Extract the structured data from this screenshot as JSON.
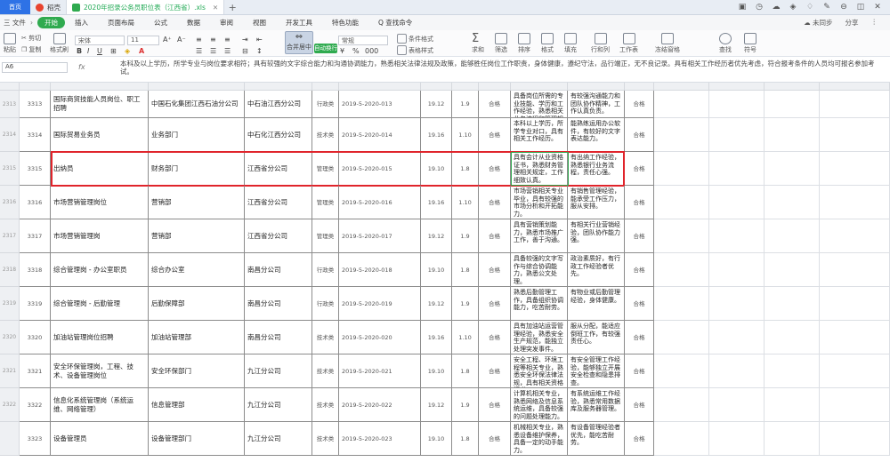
{
  "tabs": {
    "home_label": "首页",
    "items": [
      {
        "label": "稻壳",
        "color": "#e8432e",
        "active": false
      },
      {
        "label": "2020年招录公务员职位表（江西省）.xls",
        "color": "#2faa4f",
        "active": true
      }
    ],
    "plus": "+",
    "right_icons": [
      "▣",
      "◷",
      "☁",
      "◈",
      "♢",
      "✎",
      "⊖",
      "◫",
      "✕"
    ]
  },
  "menu": {
    "file": "三 文件",
    "items": [
      "开始",
      "插入",
      "页面布局",
      "公式",
      "数据",
      "审阅",
      "视图",
      "开发工具",
      "特色功能",
      "Q 查找命令"
    ],
    "active_index": 0,
    "right": [
      "☁ 未同步",
      "分享",
      "⋮"
    ]
  },
  "ribbon": {
    "cut": "✂ 剪切",
    "copy": "❐ 复制",
    "format_painter": "格式刷",
    "paste": "粘贴",
    "font_name": "宋体",
    "font_size": "11",
    "merge_center": "合并居中",
    "wrap": "自动换行",
    "currency": "常规",
    "cond_format": "条件格式",
    "table_style": "表格样式",
    "sum": "求和",
    "filter": "筛选",
    "sort": "排序",
    "format": "格式",
    "fill": "填充",
    "row_col": "行和列",
    "worksheet": "工作表",
    "freeze": "冻结窗格",
    "find": "查找",
    "symbol": "符号"
  },
  "formula_bar": {
    "namebox": "A6",
    "fx": "fx",
    "text": "本科及以上学历，所学专业与岗位要求相符；具有较强的文字综合能力和沟通协调能力，熟悉相关法律法规及政策，能够胜任岗位工作职责，身体健康，遵纪守法，品行端正，无不良记录。具有相关工作经历者优先考虑，符合报考条件的人员均可报名参加考试。"
  },
  "sheet": {
    "row_numbers": [
      "2313",
      "2314",
      "2315",
      "2316",
      "2317",
      "2318",
      "2319",
      "2320",
      "2321",
      "2322"
    ],
    "rows": [
      {
        "id": "3313",
        "name": "国际商贸技能人员岗位、职工招聘",
        "dept": "中国石化集团江西石油分公司",
        "org": "中石油江西分公司",
        "type": "行政类",
        "code": "2019-5-2020-013",
        "n1": "19.12",
        "n2": "1.9",
        "flag": "合格",
        "d1": "具备岗位所需的专业技能、学历和工作经验，熟悉相关业务流程和管理规定。",
        "d2": "有较强沟通能力和团队协作精神，工作认真负责。",
        "ex": "合格"
      },
      {
        "id": "3314",
        "name": "国际贸易业务员",
        "dept": "业务部门",
        "org": "中石化江西分公司",
        "type": "技术类",
        "code": "2019-5-2020-014",
        "n1": "19.16",
        "n2": "1.10",
        "flag": "合格",
        "d1": "本科以上学历，所学专业对口，具有相关工作经历。",
        "d2": "能熟练运用办公软件，有较好的文字表达能力。",
        "ex": "合格"
      },
      {
        "id": "3315",
        "name": "出纳员",
        "dept": "财务部门",
        "org": "江西省分公司",
        "type": "管理类",
        "code": "2019-5-2020-015",
        "n1": "19.10",
        "n2": "1.8",
        "flag": "合格",
        "d1": "具有会计从业资格证书，熟悉财务管理相关规定，工作细致认真。",
        "d2": "有出纳工作经验，熟悉银行业务流程，责任心强。",
        "ex": "合格"
      },
      {
        "id": "3316",
        "name": "市场营销管理岗位",
        "dept": "营销部",
        "org": "江西省分公司",
        "type": "管理类",
        "code": "2019-5-2020-016",
        "n1": "19.16",
        "n2": "1.10",
        "flag": "合格",
        "d1": "市场营销相关专业毕业，具有较强的市场分析和开拓能力。",
        "d2": "有销售管理经验，能承受工作压力，服从安排。",
        "ex": "合格"
      },
      {
        "id": "3317",
        "name": "市场营销管理岗",
        "dept": "营销部",
        "org": "江西省分公司",
        "type": "管理类",
        "code": "2019-5-2020-017",
        "n1": "19.12",
        "n2": "1.9",
        "flag": "合格",
        "d1": "具有营销策划能力，熟悉市场推广工作，善于沟通。",
        "d2": "有相关行业营销经验，团队协作能力强。",
        "ex": "合格"
      },
      {
        "id": "3318",
        "name": "综合管理岗 - 办公室职员",
        "dept": "综合办公室",
        "org": "南昌分公司",
        "type": "行政类",
        "code": "2019-5-2020-018",
        "n1": "19.10",
        "n2": "1.8",
        "flag": "合格",
        "d1": "具备较强的文字写作与综合协调能力，熟悉公文处理。",
        "d2": "政治素质好，有行政工作经验者优先。",
        "ex": "合格"
      },
      {
        "id": "3319",
        "name": "综合管理岗 - 后勤管理",
        "dept": "后勤保障部",
        "org": "南昌分公司",
        "type": "行政类",
        "code": "2019-5-2020-019",
        "n1": "19.12",
        "n2": "1.9",
        "flag": "合格",
        "d1": "熟悉后勤管理工作，具备组织协调能力，吃苦耐劳。",
        "d2": "有物业或后勤管理经验，身体健康。",
        "ex": "合格"
      },
      {
        "id": "3320",
        "name": "加油站管理岗位招聘",
        "dept": "加油站管理部",
        "org": "南昌分公司",
        "type": "技术类",
        "code": "2019-5-2020-020",
        "n1": "19.16",
        "n2": "1.10",
        "flag": "合格",
        "d1": "具有加油站运营管理经验，熟悉安全生产规范，能独立处理突发事件。",
        "d2": "服从分配，能适应倒班工作，有较强责任心。",
        "ex": "合格"
      },
      {
        "id": "3321",
        "name": "安全环保管理岗，工程、技术、设备管理岗位",
        "dept": "安全环保部门",
        "org": "九江分公司",
        "type": "技术类",
        "code": "2019-5-2020-021",
        "n1": "19.10",
        "n2": "1.8",
        "flag": "合格",
        "d1": "安全工程、环境工程等相关专业，熟悉安全环保法律法规，具有相关资格证书。",
        "d2": "有安全管理工作经验，能够独立开展安全检查和隐患排查。",
        "ex": "合格"
      },
      {
        "id": "3322",
        "name": "信息化系统管理岗（系统运维、网络管理）",
        "dept": "信息管理部",
        "org": "九江分公司",
        "type": "技术类",
        "code": "2019-5-2020-022",
        "n1": "19.12",
        "n2": "1.9",
        "flag": "合格",
        "d1": "计算机相关专业，熟悉网络及信息系统运维，具备较强的问题处理能力。",
        "d2": "有系统运维工作经验，熟悉常用数据库及服务器管理。",
        "ex": "合格"
      },
      {
        "id": "3323",
        "name": "设备管理员",
        "dept": "设备管理部门",
        "org": "九江分公司",
        "type": "技术类",
        "code": "2019-5-2020-023",
        "n1": "19.10",
        "n2": "1.8",
        "flag": "合格",
        "d1": "机械相关专业，熟悉设备维护保养，具备一定的动手能力。",
        "d2": "有设备管理经验者优先，能吃苦耐劳。",
        "ex": "合格"
      }
    ]
  },
  "colors": {
    "accent": "#2faa4f",
    "selection": "#e0242b",
    "tab_blue": "#2e72e6"
  }
}
